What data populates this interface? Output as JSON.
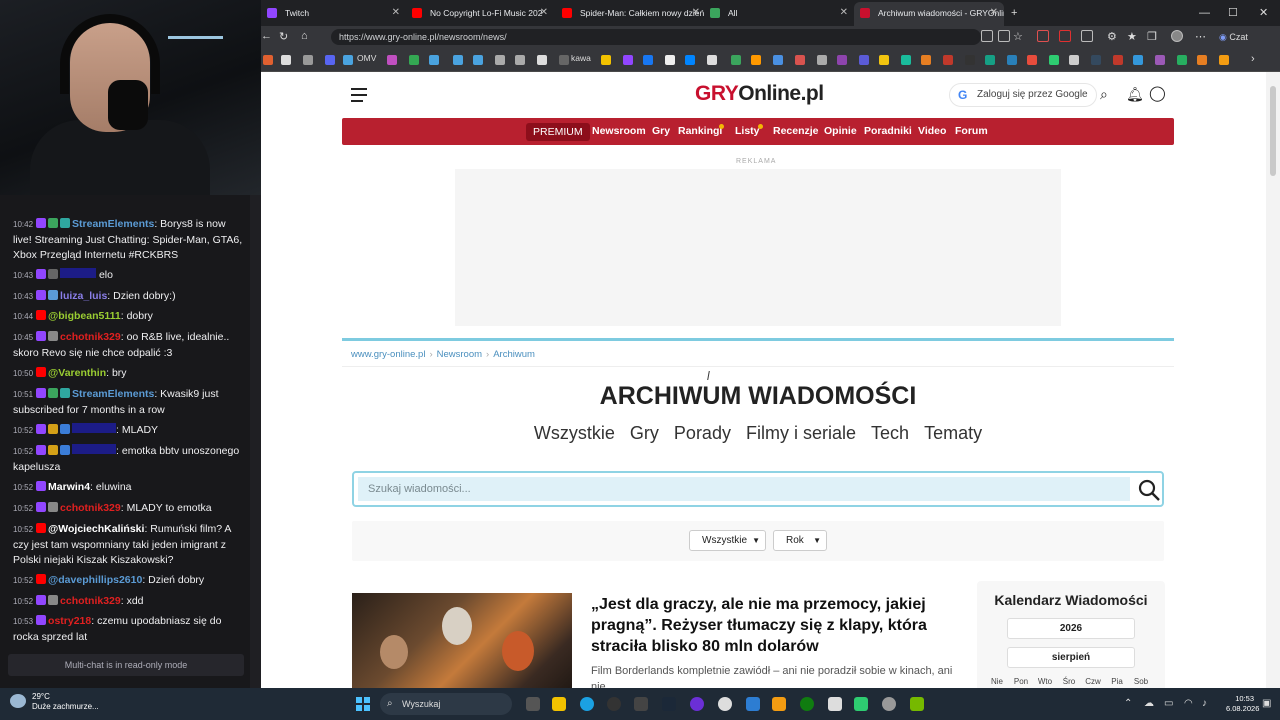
{
  "tabs": [
    {
      "label": "Twitch",
      "color": "#9146ff"
    },
    {
      "label": "No Copyright Lo-Fi Music 202",
      "color": "#ff0000"
    },
    {
      "label": "Spider-Man: Całkiem nowy dzień",
      "color": "#ff0000"
    },
    {
      "label": "All",
      "color": "#3ba55d"
    },
    {
      "label": "Archiwum wiadomości - GRYOnlin",
      "color": "#c8102e"
    }
  ],
  "address": {
    "url": "https://www.gry-online.pl/newsroom/news/"
  },
  "bookmarks": {
    "omv": "OMV",
    "kawa": "kawa"
  },
  "copilot": {
    "label": "Czat"
  },
  "chat": {
    "lines": [
      {
        "ts": "10:42",
        "user": "StreamElements",
        "user_color": "#5b9bd5",
        "msg": "Borys8 is now live! Streaming Just Chatting: Spider-Man, GTA6, Xbox Przegląd Internetu #RCKBRS"
      },
      {
        "ts": "10:43",
        "user": "",
        "user_color": "#1f1fd0",
        "msg": "elo"
      },
      {
        "ts": "10:43",
        "user": "luiza_luis",
        "user_color": "#8a7ee8",
        "msg": "Dzien dobry:)"
      },
      {
        "ts": "10:44",
        "user": "@bigbean5111",
        "user_color": "#9acd32",
        "msg": "dobry"
      },
      {
        "ts": "10:45",
        "user": "cchotnik329",
        "user_color": "#e02020",
        "msg": "oo R&B live, idealnie.. skoro Revo się nie chce odpalić :3"
      },
      {
        "ts": "10:50",
        "user": "@Varenthin",
        "user_color": "#9acd32",
        "msg": "bry"
      },
      {
        "ts": "10:51",
        "user": "StreamElements",
        "user_color": "#5b9bd5",
        "msg": "Kwasik9 just subscribed for 7 months in a row"
      },
      {
        "ts": "10:52",
        "user": "",
        "user_color": "#1f1fd0",
        "msg": "MLADY"
      },
      {
        "ts": "10:52",
        "user": "",
        "user_color": "#1f1fd0",
        "msg": "emotka bbtv unoszonego kapelusza"
      },
      {
        "ts": "10:52",
        "user": "Marwin4",
        "user_color": "#ffffff",
        "msg": "eluwina"
      },
      {
        "ts": "10:52",
        "user": "cchotnik329",
        "user_color": "#e02020",
        "msg": "MLADY to emotka"
      },
      {
        "ts": "10:52",
        "user": "@WojciechKaliński",
        "user_color": "#ffffff",
        "msg": "Rumuński film? A czy jest tam wspomniany taki jeden imigrant z Polski niejaki Kiszak Kiszakowski?"
      },
      {
        "ts": "10:52",
        "user": "@davephillips2610",
        "user_color": "#5b9bd5",
        "msg": "Dzień dobry"
      },
      {
        "ts": "10:52",
        "user": "cchotnik329",
        "user_color": "#e02020",
        "msg": "xdd"
      },
      {
        "ts": "10:53",
        "user": "ostry218",
        "user_color": "#e02020",
        "msg": "czemu upodabniasz się do rocka sprzed lat"
      }
    ],
    "readonly": "Multi-chat is in read-only mode"
  },
  "site": {
    "logo_a": "GRY",
    "logo_b": "Online.pl",
    "login": "Zaloguj się przez Google",
    "nav": {
      "premium": "PREMIUM",
      "newsroom": "Newsroom",
      "gry": "Gry",
      "rankingi": "Rankingi",
      "listy": "Listy",
      "recenzje": "Recenzje",
      "opinie": "Opinie",
      "poradniki": "Poradniki",
      "video": "Video",
      "forum": "Forum"
    },
    "ad_label": "REKLAMA",
    "breadcrumb": [
      "www.gry-online.pl",
      "Newsroom",
      "Archiwum"
    ],
    "title": "ARCHIWUM WIADOMOŚCI",
    "categories": [
      "Wszystkie",
      "Gry",
      "Porady",
      "Filmy i seriale",
      "Tech",
      "Tematy"
    ],
    "search_placeholder": "Szukaj wiadomości...",
    "filter_all": "Wszystkie",
    "filter_year": "Rok",
    "article": {
      "title": "„Jest dla graczy, ale nie ma przemocy, jakiej pragną”. Reżyser tłumaczy się z klapy, która straciła blisko 80 mln dolarów",
      "lead": "Film Borderlands kompletnie zawiódł – ani nie poradził sobie w kinach, ani nie"
    },
    "calendar": {
      "title": "Kalendarz Wiadomości",
      "year": "2026",
      "month": "sierpień",
      "days": [
        "Nie",
        "Pon",
        "Wto",
        "Śro",
        "Czw",
        "Pia",
        "Sob"
      ]
    }
  },
  "taskbar": {
    "temp": "29°C",
    "weather": "Duże zachmurze...",
    "search": "Wyszukaj",
    "time": "10:53",
    "date": "6.08.2026"
  }
}
